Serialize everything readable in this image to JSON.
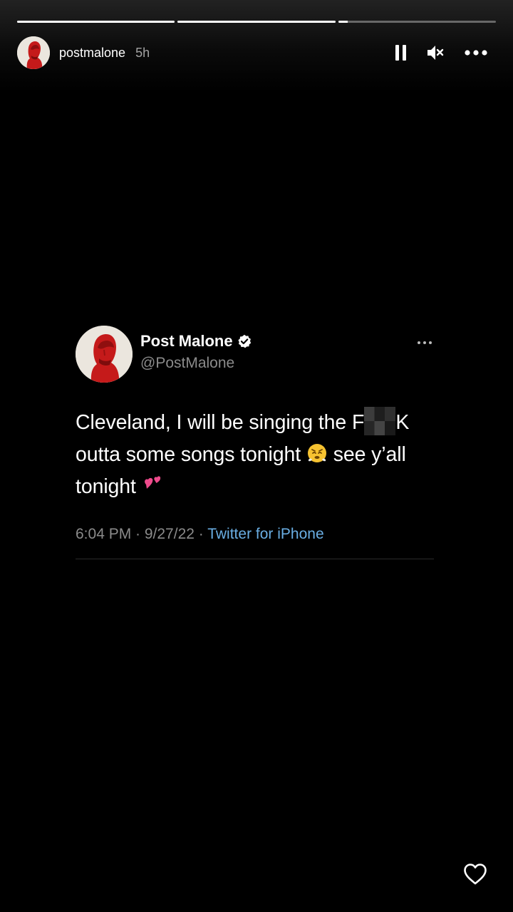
{
  "story": {
    "username": "postmalone",
    "time_ago": "5h",
    "progress": [
      1,
      1,
      0.06
    ],
    "controls": {
      "pause": "pause-icon",
      "mute": "mute-icon",
      "more": "more-icon"
    }
  },
  "tweet": {
    "display_name": "Post Malone",
    "handle": "@PostMalone",
    "text_part1": "Cleveland, I will be singing the F",
    "text_part2": "K outta some songs tonight ",
    "text_part3": " see y’all tonight ",
    "timestamp": "6:04 PM · 9/27/22 · ",
    "source": "Twitter for iPhone"
  },
  "footer": {
    "like_icon": "heart-outline-icon"
  }
}
